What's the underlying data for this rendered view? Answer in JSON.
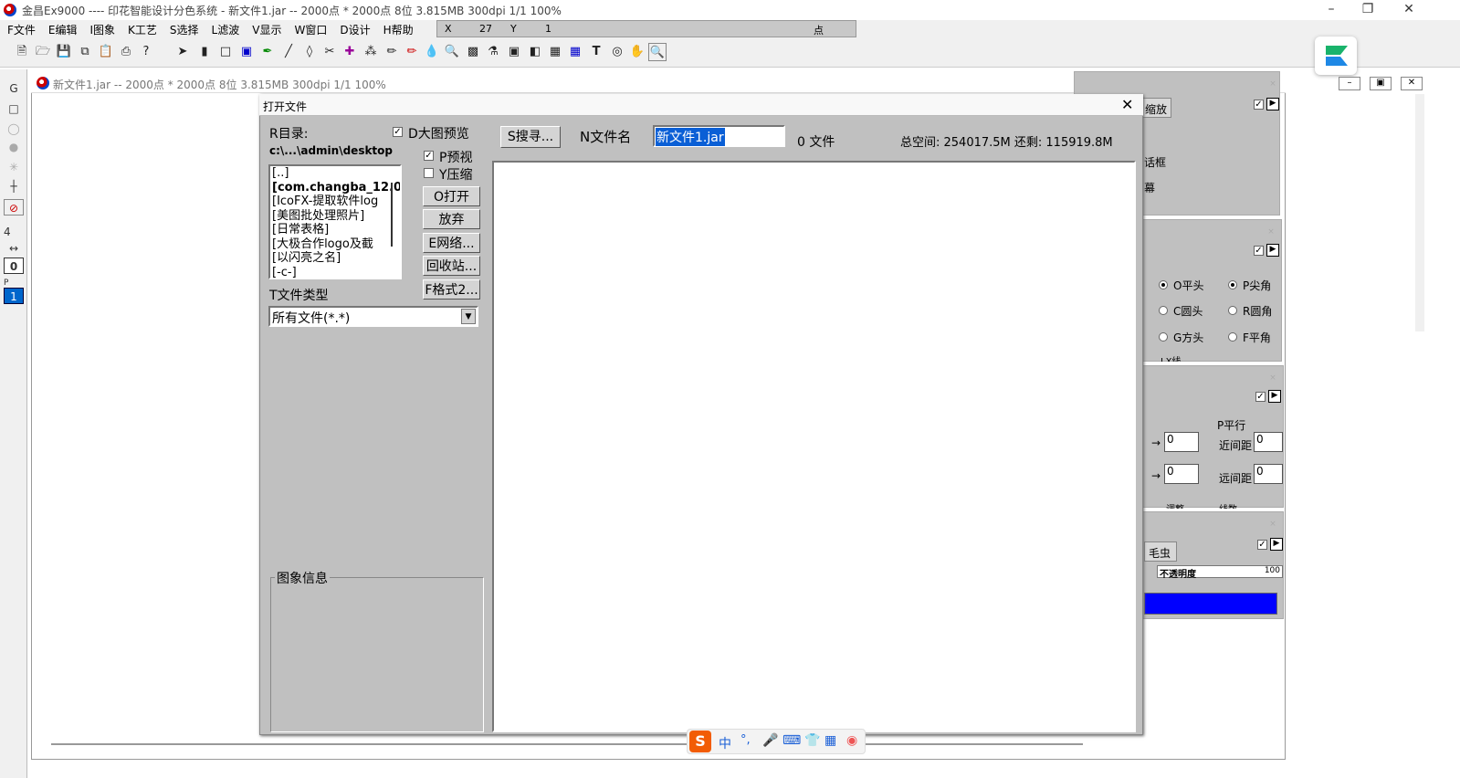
{
  "window_title": "金昌Ex9000 ---- 印花智能设计分色系统 - 新文件1.jar -- 2000点 * 2000点 8位   3.815MB 300dpi 1/1   100%",
  "menu": [
    "F文件",
    "E编辑",
    "I图象",
    "K工艺",
    "S选择",
    "L滤波",
    "V显示",
    "W窗口",
    "D设计",
    "H帮助"
  ],
  "coords": {
    "x_label": "X",
    "x_value": "27",
    "y_label": "Y",
    "y_value": "1",
    "unit": "点"
  },
  "mdi_title": "新文件1.jar -- 2000点 * 2000点 8位   3.815MB 300dpi 1/1   100%",
  "left_tools": {
    "g": "G",
    "num4": "4",
    "num0": "0",
    "num1": "1",
    "p": "P"
  },
  "dialog": {
    "title": "打开文件",
    "dir_label": "R目录:",
    "dir_path": "c:\\...\\admin\\desktop",
    "big_preview": "D大图预览",
    "preview": "P预视",
    "compress": "Y压缩",
    "dir_items": [
      "[..]",
      "[com.changba_12.0",
      "[IcoFX-提取软件log",
      "[美图批处理照片]",
      "[日常表格]",
      "[大极合作logo及截",
      "[以闪亮之名]",
      "[-c-]"
    ],
    "btn_open": "O打开",
    "btn_cancel": "放弃",
    "btn_network": "E网络...",
    "btn_recycle": "回收站...",
    "btn_format": "F格式2...",
    "filetype_label": "T文件类型",
    "filetype_value": "所有文件(*.*)",
    "search_btn": "S搜寻...",
    "filename_label": "N文件名",
    "filename_value": "新文件1.jar",
    "file_count": "0 文件",
    "space_info": "总空间: 254017.5M  还剩: 115919.8M",
    "image_info": "图象信息"
  },
  "right_panels": {
    "p1_tab": "缩放",
    "p1_item1": "话框",
    "p1_item2": "幕",
    "p2_radios": [
      "O平头",
      "P尖角",
      "C圆头",
      "R圆角",
      "G方头",
      "F平角"
    ],
    "p2_partial": "LX线",
    "p3_group": "P平行",
    "p3_near": "近间距",
    "p3_far": "远间距",
    "p3_val": "0",
    "p3_adjust": "调整",
    "p3_count": "线数",
    "p4_tab": "毛虫",
    "p4_opacity": "不透明度",
    "p4_value": "100",
    "p4_color": "#0000ff"
  },
  "ime": {
    "zh": "中",
    "punct": "°,"
  }
}
